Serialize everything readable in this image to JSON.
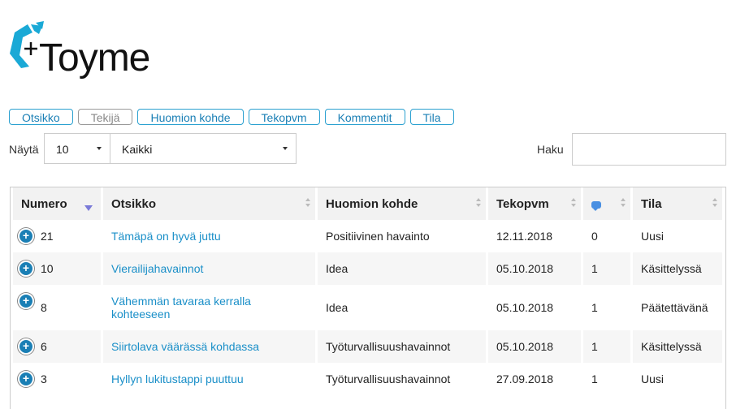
{
  "logo": {
    "text": "Toyme",
    "accent_color": "#1aa9d6"
  },
  "column_toggles": [
    {
      "label": "Otsikko",
      "active": true
    },
    {
      "label": "Tekijä",
      "active": false
    },
    {
      "label": "Huomion kohde",
      "active": true
    },
    {
      "label": "Tekopvm",
      "active": true
    },
    {
      "label": "Kommentit",
      "active": true
    },
    {
      "label": "Tila",
      "active": true
    }
  ],
  "controls": {
    "show_label": "Näytä",
    "page_size": "10",
    "filter": "Kaikki",
    "search_label": "Haku",
    "search_value": ""
  },
  "table": {
    "headers": {
      "numero": "Numero",
      "otsikko": "Otsikko",
      "kohde": "Huomion kohde",
      "tekopvm": "Tekopvm",
      "kommentit_icon": "comment-icon",
      "tila": "Tila"
    },
    "rows": [
      {
        "numero": "21",
        "otsikko": "Tämäpä on hyvä juttu",
        "kohde": "Positiivinen havainto",
        "tekopvm": "12.11.2018",
        "kommentit": "0",
        "tila": "Uusi"
      },
      {
        "numero": "10",
        "otsikko": "Vierailijahavainnot",
        "kohde": "Idea",
        "tekopvm": "05.10.2018",
        "kommentit": "1",
        "tila": "Käsittelyssä"
      },
      {
        "numero": "8",
        "otsikko": "Vähemmän tavaraa kerralla kohteeseen",
        "kohde": "Idea",
        "tekopvm": "05.10.2018",
        "kommentit": "1",
        "tila": "Päätettävänä"
      },
      {
        "numero": "6",
        "otsikko": "Siirtolava väärässä kohdassa",
        "kohde": "Työturvallisuushavainnot",
        "tekopvm": "05.10.2018",
        "kommentit": "1",
        "tila": "Käsittelyssä"
      },
      {
        "numero": "3",
        "otsikko": "Hyllyn lukitustappi puuttuu",
        "kohde": "Työturvallisuushavainnot",
        "tekopvm": "27.09.2018",
        "kommentit": "1",
        "tila": "Uusi"
      }
    ]
  }
}
